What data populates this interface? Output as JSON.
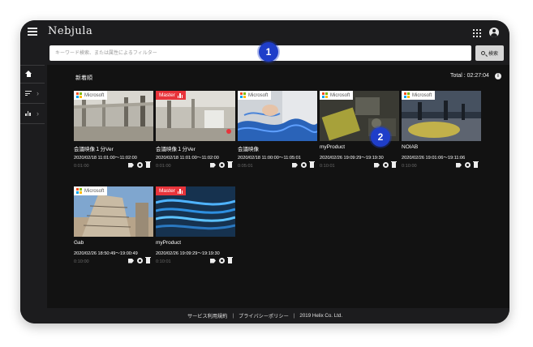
{
  "app": {
    "title": "Nebjula"
  },
  "search": {
    "placeholder": "キーワード検索、または属性によるフィルター",
    "button_label": "検索"
  },
  "section": {
    "title": "新着順",
    "total_label": "Total : 02:27:04"
  },
  "callouts": [
    "1",
    "2"
  ],
  "badges": {
    "microsoft": "Microsoft",
    "master": "Master"
  },
  "cards": [
    {
      "title": "会議映像１分Ver",
      "date": "2020/02/18 11:01:00〜11:02:00",
      "duration": "0:01:00",
      "badge": "microsoft"
    },
    {
      "title": "会議映像１分Ver",
      "date": "2020/02/18 11:01:00〜11:02:00",
      "duration": "0:01:00",
      "badge": "master"
    },
    {
      "title": "会議映像",
      "date": "2020/02/18 11:00:00〜11:05:01",
      "duration": "0:05:01",
      "badge": "microsoft"
    },
    {
      "title": "myProduct",
      "date": "2020/02/26 19:09:29〜19:19:30",
      "duration": "0:10:01",
      "badge": "microsoft"
    },
    {
      "title": "NOIAB",
      "date": "2020/02/26 19:01:06〜19:11:06",
      "duration": "0:10:00",
      "badge": "microsoft"
    },
    {
      "title": "Gab",
      "date": "2020/02/26 18:50:49〜19:00:49",
      "duration": "0:10:00",
      "badge": "microsoft"
    },
    {
      "title": "myProduct",
      "date": "2020/02/26 19:09:29〜19:19:30",
      "duration": "0:10:01",
      "badge": "master"
    }
  ],
  "footer": {
    "terms": "サービス利用規約",
    "privacy": "プライバシーポリシー",
    "copyright": "2019 Helix Co. Ltd."
  },
  "colors": {
    "accent": "#1f3ec9",
    "master": "#e8343b",
    "background": "#121212"
  }
}
